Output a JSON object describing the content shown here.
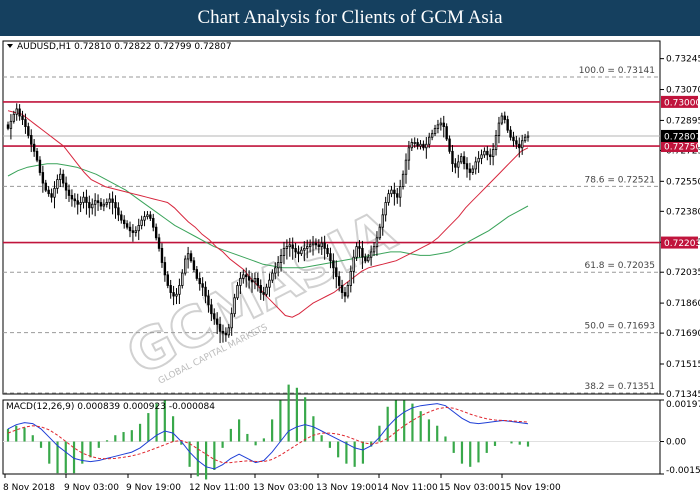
{
  "header": {
    "title": "Chart Analysis for Clients of GCM Asia"
  },
  "watermark": {
    "text": "GCMASIA",
    "sub": "GLOBAL CAPITAL MARKETS"
  },
  "colors": {
    "banner": "#15405f",
    "bull": "#000000",
    "bear": "#000000",
    "ma_fast": "#d7263d",
    "ma_slow": "#3aa35a",
    "resistance": "#c0143c",
    "fib": "#9a9a9a",
    "macd_line": "#1f3fd6",
    "signal_line": "#e0262e",
    "hist": "#38a84a",
    "price_tag_bg": "#000000"
  },
  "chart_data": [
    {
      "type": "candlestick",
      "instrument_header": "AUDUSD,H1  0.72810 0.72822 0.72799 0.72807",
      "price_axis": {
        "ylim": [
          0.71345,
          0.73345
        ],
        "ticks": [
          0.73245,
          0.7307,
          0.72895,
          0.72725,
          0.7255,
          0.7238,
          0.72205,
          0.72035,
          0.7186,
          0.7169,
          0.71515,
          0.71345
        ],
        "tick_labels": [
          "0.73245",
          "0.73070",
          "0.72895",
          "0.72725",
          "0.72550",
          "0.72380",
          "0.72205",
          "0.72035",
          "0.71860",
          "0.71690",
          "0.71515",
          "0.71345"
        ]
      },
      "current_price": {
        "value": 0.72807,
        "label": "0.72807"
      },
      "horizontal_levels": [
        {
          "value": 0.73,
          "label": "0.73000"
        },
        {
          "value": 0.7275,
          "label": "0.72750"
        },
        {
          "value": 0.72203,
          "label": "0.72203"
        }
      ],
      "fibonacci": [
        {
          "value": 0.73141,
          "label": "100.0 = 0.73141"
        },
        {
          "value": 0.72521,
          "label": "78.6 = 0.72521"
        },
        {
          "value": 0.72035,
          "label": "61.8 = 0.72035"
        },
        {
          "value": 0.71693,
          "label": "50.0 = 0.71693"
        },
        {
          "value": 0.71351,
          "label": "38.2 = 0.71351"
        }
      ],
      "x_labels": [
        "8 Nov 2018",
        "9 Nov 03:00",
        "9 Nov 19:00",
        "12 Nov 11:00",
        "13 Nov 03:00",
        "13 Nov 19:00",
        "14 Nov 11:00",
        "15 Nov 03:00",
        "15 Nov 19:00"
      ],
      "closes": [
        0.7285,
        0.7289,
        0.7293,
        0.7296,
        0.7292,
        0.729,
        0.7286,
        0.7281,
        0.7276,
        0.7272,
        0.7267,
        0.726,
        0.7254,
        0.725,
        0.7248,
        0.7246,
        0.7251,
        0.7256,
        0.7259,
        0.7254,
        0.725,
        0.7247,
        0.7245,
        0.7244,
        0.7242,
        0.7243,
        0.7246,
        0.7243,
        0.724,
        0.7242,
        0.7244,
        0.7243,
        0.7241,
        0.7242,
        0.7243,
        0.7245,
        0.7243,
        0.724,
        0.7236,
        0.7233,
        0.7231,
        0.7229,
        0.7227,
        0.7226,
        0.7227,
        0.723,
        0.7233,
        0.7235,
        0.7236,
        0.7234,
        0.7229,
        0.7223,
        0.7217,
        0.7209,
        0.7202,
        0.7196,
        0.7192,
        0.719,
        0.7191,
        0.7196,
        0.7203,
        0.7211,
        0.7214,
        0.721,
        0.7205,
        0.72,
        0.7197,
        0.7195,
        0.719,
        0.7185,
        0.718,
        0.7177,
        0.7174,
        0.717,
        0.7169,
        0.7168,
        0.7172,
        0.718,
        0.7189,
        0.7196,
        0.72,
        0.7202,
        0.7201,
        0.7199,
        0.7198,
        0.72,
        0.7196,
        0.7192,
        0.7191,
        0.7195,
        0.7199,
        0.7203,
        0.7206,
        0.7209,
        0.7213,
        0.7217,
        0.7218,
        0.7219,
        0.7217,
        0.7215,
        0.7214,
        0.7216,
        0.7217,
        0.7218,
        0.7219,
        0.722,
        0.7219,
        0.7218,
        0.722,
        0.7217,
        0.7214,
        0.721,
        0.7206,
        0.7201,
        0.7196,
        0.7192,
        0.719,
        0.7196,
        0.7204,
        0.7212,
        0.7218,
        0.7217,
        0.7212,
        0.721,
        0.7212,
        0.7215,
        0.7218,
        0.7223,
        0.7229,
        0.7236,
        0.7243,
        0.7248,
        0.725,
        0.7248,
        0.7246,
        0.7252,
        0.7259,
        0.7267,
        0.7274,
        0.7277,
        0.7277,
        0.7275,
        0.7276,
        0.7274,
        0.7276,
        0.728,
        0.7282,
        0.7285,
        0.7287,
        0.7288,
        0.7286,
        0.7279,
        0.7272,
        0.7265,
        0.7263,
        0.7266,
        0.7269,
        0.7265,
        0.7262,
        0.726,
        0.7262,
        0.7266,
        0.7268,
        0.727,
        0.7272,
        0.727,
        0.7269,
        0.7273,
        0.7281,
        0.7288,
        0.7292,
        0.729,
        0.7284,
        0.728,
        0.7278,
        0.7276,
        0.7274,
        0.7278,
        0.728,
        0.72807
      ],
      "ma_fast": {
        "name": "",
        "values": [
          0.7295,
          0.7294,
          0.7293,
          0.729,
          0.7287,
          0.7284,
          0.7281,
          0.7278,
          0.7275,
          0.727,
          0.7265,
          0.726,
          0.7256,
          0.7254,
          0.7252,
          0.7251,
          0.725,
          0.7249,
          0.7248,
          0.7247,
          0.7246,
          0.7245,
          0.7244,
          0.7243,
          0.724,
          0.7236,
          0.7232,
          0.7229,
          0.7225,
          0.7222,
          0.7218,
          0.7215,
          0.7211,
          0.7208,
          0.7205,
          0.72,
          0.7196,
          0.7191,
          0.7187,
          0.7183,
          0.7179,
          0.7178,
          0.718,
          0.7183,
          0.7186,
          0.7188,
          0.719,
          0.7192,
          0.7195,
          0.7198,
          0.7201,
          0.7204,
          0.7206,
          0.7207,
          0.7208,
          0.7209,
          0.721,
          0.7212,
          0.7214,
          0.7216,
          0.7218,
          0.722,
          0.7223,
          0.7227,
          0.7231,
          0.7235,
          0.724,
          0.7244,
          0.7248,
          0.7252,
          0.7256,
          0.726,
          0.7264,
          0.7268,
          0.7272,
          0.7274
        ]
      },
      "ma_slow": {
        "name": "",
        "values": [
          0.7258,
          0.7261,
          0.7263,
          0.7264,
          0.7265,
          0.7265,
          0.7264,
          0.7263,
          0.7261,
          0.7259,
          0.7256,
          0.7253,
          0.725,
          0.7246,
          0.7242,
          0.7238,
          0.7234,
          0.723,
          0.7227,
          0.7224,
          0.7221,
          0.7218,
          0.7216,
          0.7214,
          0.7212,
          0.721,
          0.7208,
          0.7207,
          0.7206,
          0.7206,
          0.7206,
          0.7207,
          0.7208,
          0.7209,
          0.721,
          0.7211,
          0.7212,
          0.7213,
          0.7214,
          0.7215,
          0.7215,
          0.7214,
          0.7213,
          0.7213,
          0.7214,
          0.7215,
          0.7218,
          0.7221,
          0.7224,
          0.7227,
          0.7231,
          0.7235,
          0.7238,
          0.7241
        ]
      },
      "macd": {
        "header": "MACD(12,26,9) 0.000839 0.000923 -0.000084",
        "ylim": [
          -0.00154,
          0.00197
        ],
        "ticks": [
          0.00197,
          0.0,
          -0.00154
        ],
        "tick_labels": [
          "0.00197",
          "0.00",
          "-0.00154"
        ],
        "macd_line": [
          0.0006,
          0.0008,
          0.0009,
          0.00085,
          0.0006,
          0.0002,
          -0.0002,
          -0.0005,
          -0.0008,
          -0.0009,
          -0.00095,
          -0.0009,
          -0.0008,
          -0.0007,
          -0.0006,
          -0.0005,
          -0.0003,
          0.0,
          0.0003,
          0.0005,
          0.0004,
          0.0,
          -0.0005,
          -0.0009,
          -0.0012,
          -0.0013,
          -0.0011,
          -0.0008,
          -0.0006,
          -0.0008,
          -0.001,
          -0.0009,
          -0.0005,
          0.0,
          0.0005,
          0.0007,
          0.0008,
          0.0007,
          0.0005,
          0.0003,
          0.0001,
          -0.0001,
          -0.0003,
          -0.0004,
          -0.0002,
          0.0002,
          0.0007,
          0.0011,
          0.0014,
          0.0016,
          0.0017,
          0.00175,
          0.0018,
          0.0017,
          0.0014,
          0.0011,
          0.0009,
          0.00085,
          0.0009,
          0.00095,
          0.001,
          0.00095,
          0.0009,
          0.00084
        ],
        "signal_line": [
          0.0004,
          0.00055,
          0.00068,
          0.00075,
          0.0007,
          0.00055,
          0.0003,
          0.0,
          -0.0003,
          -0.00055,
          -0.0007,
          -0.0008,
          -0.00082,
          -0.0008,
          -0.00075,
          -0.00068,
          -0.00058,
          -0.00045,
          -0.0003,
          -0.00015,
          0.0,
          5e-05,
          -0.0001,
          -0.00035,
          -0.0006,
          -0.00085,
          -0.001,
          -0.001,
          -0.00095,
          -0.00092,
          -0.00094,
          -0.00095,
          -0.00085,
          -0.00065,
          -0.0004,
          -0.00015,
          0.0001,
          0.0003,
          0.0004,
          0.0004,
          0.00035,
          0.00025,
          0.0001,
          -5e-05,
          -0.00012,
          -5e-05,
          0.00015,
          0.00045,
          0.00075,
          0.001,
          0.00122,
          0.0014,
          0.00155,
          0.00162,
          0.00158,
          0.00145,
          0.0013,
          0.00118,
          0.00108,
          0.00102,
          0.001,
          0.00098,
          0.00095,
          0.00092
        ]
      }
    }
  ]
}
